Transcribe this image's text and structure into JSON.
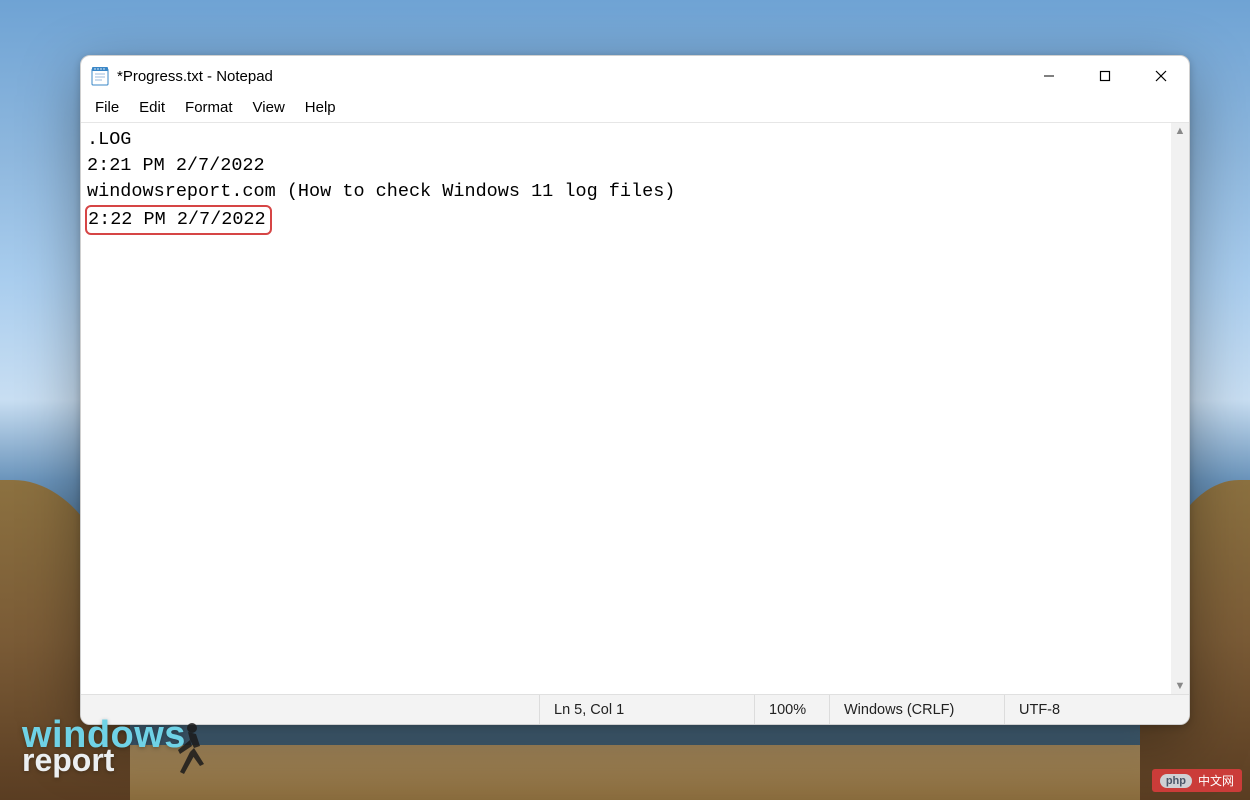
{
  "window": {
    "title": "*Progress.txt - Notepad"
  },
  "menus": {
    "file": "File",
    "edit": "Edit",
    "format": "Format",
    "view": "View",
    "help": "Help"
  },
  "document": {
    "lines": {
      "l1": ".LOG",
      "l2": "2:21 PM 2/7/2022",
      "l3": "windowsreport.com (How to check Windows 11 log files)",
      "l4_highlighted": "2:22 PM 2/7/2022"
    }
  },
  "statusbar": {
    "position": "Ln 5, Col 1",
    "zoom": "100%",
    "line_ending": "Windows (CRLF)",
    "encoding": "UTF-8"
  },
  "watermarks": {
    "wr_line1": "windows",
    "wr_line2": "report",
    "php_pill": "php",
    "php_text": "中文网"
  },
  "icons": {
    "app": "notepad-icon",
    "minimize": "minimize-icon",
    "maximize": "maximize-icon",
    "close": "close-icon",
    "scroll_up": "scroll-up-arrow",
    "scroll_down": "scroll-down-arrow"
  }
}
